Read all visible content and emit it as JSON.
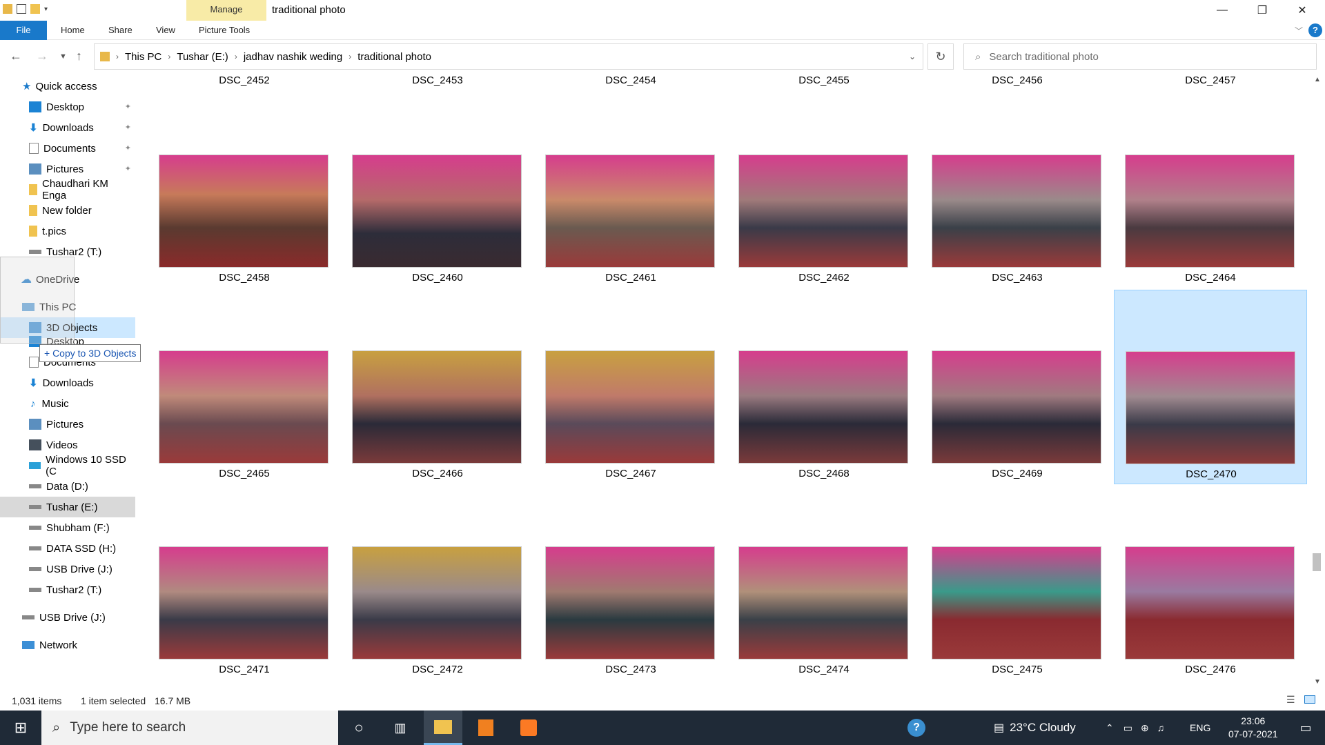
{
  "window": {
    "title": "traditional photo",
    "contextual_tab": "Manage",
    "minimize": "—",
    "maximize": "❐",
    "close": "✕"
  },
  "ribbon": {
    "tabs": [
      "File",
      "Home",
      "Share",
      "View",
      "Picture Tools"
    ],
    "help": "?"
  },
  "address": {
    "breadcrumbs": [
      "This PC",
      "Tushar (E:)",
      "jadhav nashik weding",
      "traditional photo"
    ]
  },
  "search": {
    "placeholder": "Search traditional photo"
  },
  "sidebar": {
    "quick_access": "Quick access",
    "quick_items": [
      "Desktop",
      "Downloads",
      "Documents",
      "Pictures",
      "Chaudhari KM Enga",
      "New folder",
      "t.pics",
      "Tushar2 (T:)"
    ],
    "onedrive": "OneDrive",
    "this_pc": "This PC",
    "pc_items": [
      "3D Objects",
      "Desktop",
      "Documents",
      "Downloads",
      "Music",
      "Pictures",
      "Videos",
      "Windows 10 SSD (C",
      "Data (D:)",
      "Tushar (E:)",
      "Shubham (F:)",
      "DATA SSD (H:)",
      "USB Drive (J:)",
      "Tushar2 (T:)"
    ],
    "usb": "USB Drive (J:)",
    "network": "Network",
    "tooltip": "+ Copy to 3D Objects"
  },
  "files": {
    "top_row": [
      "DSC_2452",
      "DSC_2453",
      "DSC_2454",
      "DSC_2455",
      "DSC_2456",
      "DSC_2457"
    ],
    "rows": [
      [
        "DSC_2458",
        "DSC_2460",
        "DSC_2461",
        "DSC_2462",
        "DSC_2463",
        "DSC_2464"
      ],
      [
        "DSC_2465",
        "DSC_2466",
        "DSC_2467",
        "DSC_2468",
        "DSC_2469",
        "DSC_2470"
      ],
      [
        "DSC_2471",
        "DSC_2472",
        "DSC_2473",
        "DSC_2474",
        "DSC_2475",
        "DSC_2476"
      ]
    ],
    "selected": "DSC_2470"
  },
  "status": {
    "count": "1,031 items",
    "selection": "1 item selected",
    "size": "16.7 MB"
  },
  "taskbar": {
    "search_placeholder": "Type here to search",
    "weather": "23°C  Cloudy",
    "lang": "ENG",
    "time": "23:06",
    "date": "07-07-2021"
  },
  "colors": {
    "accent": "#1979ca",
    "selection": "#cce8ff",
    "manage_tab": "#f8eba7",
    "taskbar": "#1f2a37"
  }
}
